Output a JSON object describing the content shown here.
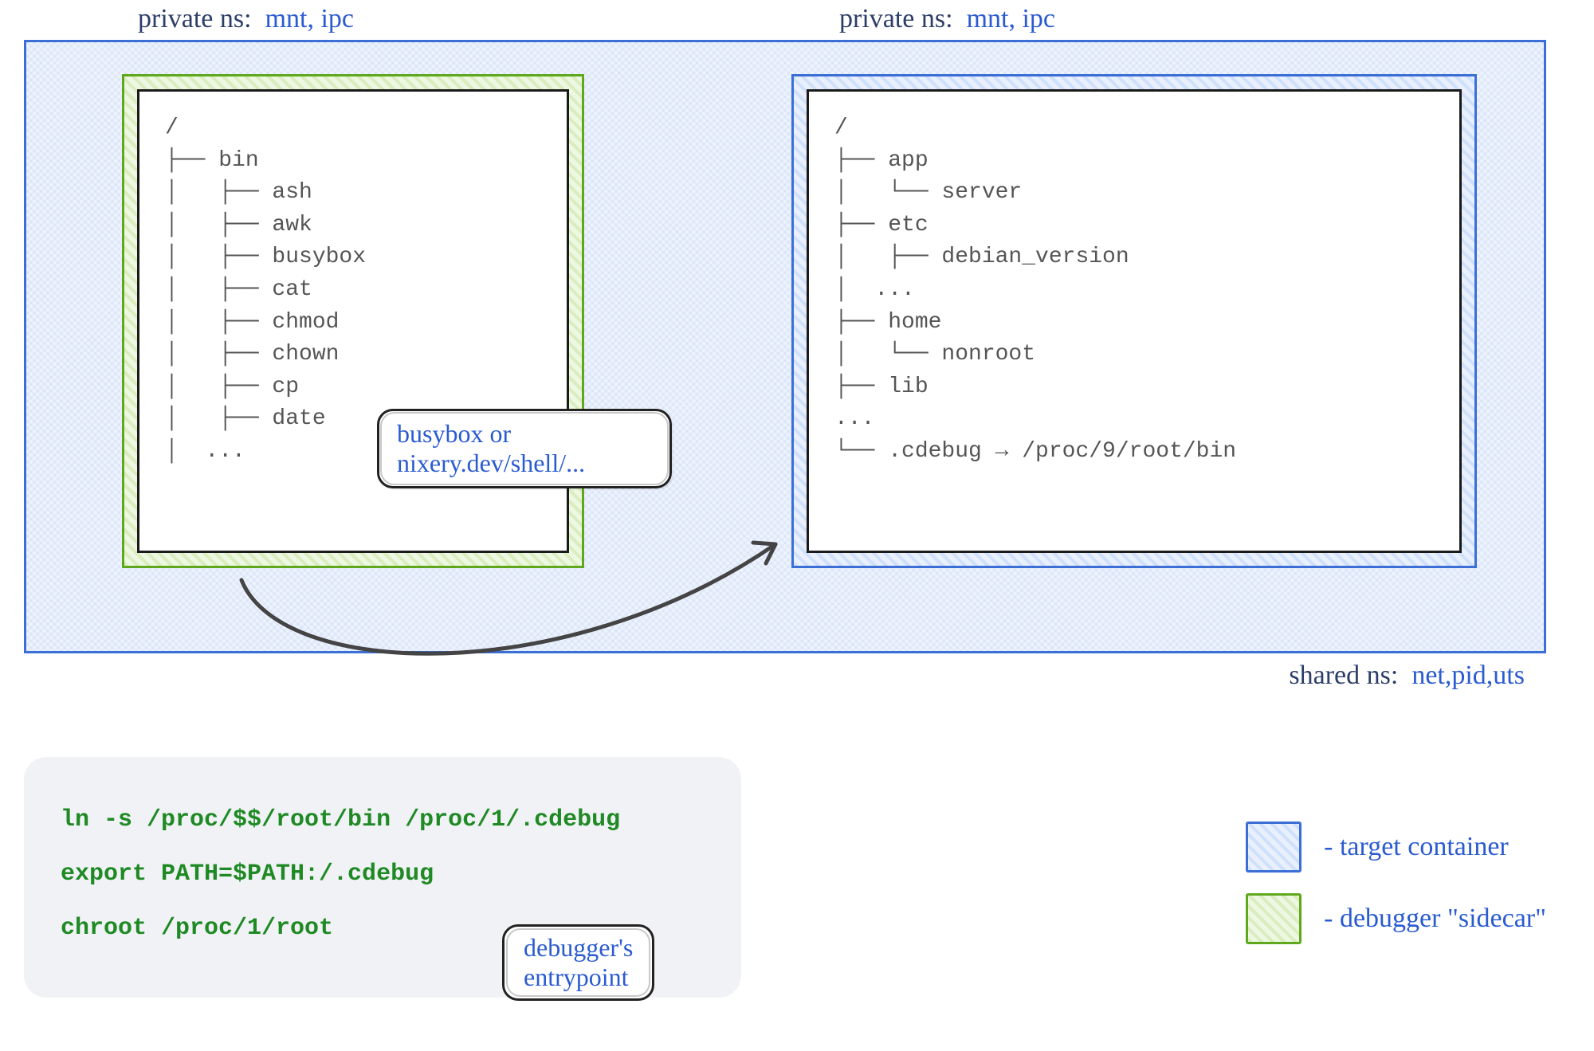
{
  "ns_left": {
    "label": "private ns:",
    "values": "mnt, ipc"
  },
  "ns_right": {
    "label": "private ns:",
    "values": "mnt, ipc"
  },
  "shared_ns": {
    "label": "shared ns:",
    "values": "net,pid,uts"
  },
  "left_tree": {
    "root": "/",
    "lines": [
      "├── bin",
      "│   ├── ash",
      "│   ├── awk",
      "│   ├── busybox",
      "│   ├── cat",
      "│   ├── chmod",
      "│   ├── chown",
      "│   ├── cp",
      "│   ├── date",
      "│  ..."
    ]
  },
  "right_tree": {
    "root": "/",
    "lines": [
      "├── app",
      "│   └── server",
      "├── etc",
      "│   ├── debian_version",
      "│  ...",
      "├── home",
      "│   └── nonroot",
      "├── lib",
      "...",
      "└── .cdebug → /proc/9/root/bin"
    ]
  },
  "callout_left": {
    "line1": "busybox or",
    "line2": "nixery.dev/shell/..."
  },
  "entrypoint_callout": {
    "line1": "debugger's",
    "line2": "entrypoint"
  },
  "code_lines": [
    "ln -s /proc/$$/root/bin /proc/1/.cdebug",
    "export PATH=$PATH:/.cdebug",
    "chroot /proc/1/root"
  ],
  "legend": {
    "target": "- target container",
    "sidecar": "- debugger \"sidecar\""
  }
}
